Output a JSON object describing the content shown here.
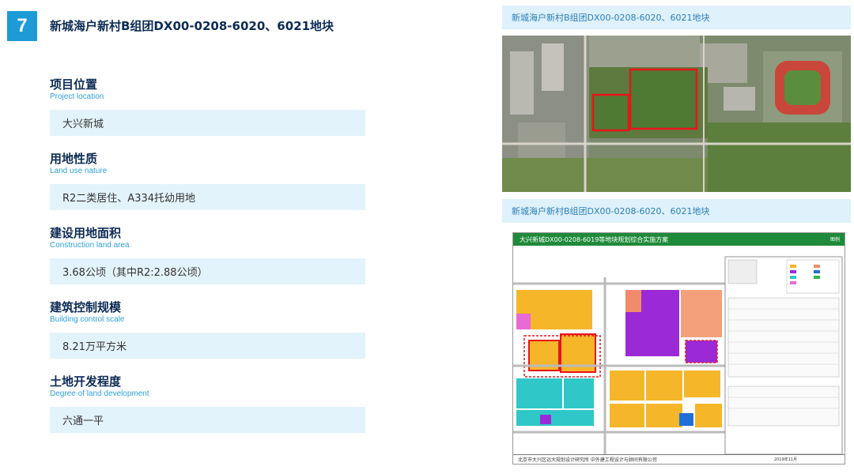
{
  "page_number": "7",
  "main_title": "新城海户新村B组团DX00-0208-6020、6021地块",
  "sections": [
    {
      "title_cn": "项目位置",
      "title_en": "Project location",
      "value": "大兴新城"
    },
    {
      "title_cn": "用地性质",
      "title_en": "Land use nature",
      "value": "R2二类居住、A334托幼用地"
    },
    {
      "title_cn": "建设用地面积",
      "title_en": "Construction land area",
      "value": "3.68公顷（其中R2:2.88公顷）"
    },
    {
      "title_cn": "建筑控制规模",
      "title_en": "Building control scale",
      "value": "8.21万平方米"
    },
    {
      "title_cn": "土地开发程度",
      "title_en": "Degree of land development",
      "value": "六通一平"
    }
  ],
  "captions": {
    "satellite": "新城海户新村B组团DX00-0208-6020、6021地块",
    "plan": "新城海户新村B组团DX00-0208-6020、6021地块"
  },
  "plan": {
    "title": "大兴新城DX00-0208-6019等地块规划综合实施方案",
    "figure_label": "图例",
    "footer": "北京市大兴区远大规划设计研究所    中外建工程设计与顾问有限公司",
    "date": "2019年11月"
  },
  "colors": {
    "accent": "#1d9bd7",
    "caption_bg": "#dff1fb",
    "value_bg": "#e3f3fb",
    "heading": "#0d2b55"
  }
}
